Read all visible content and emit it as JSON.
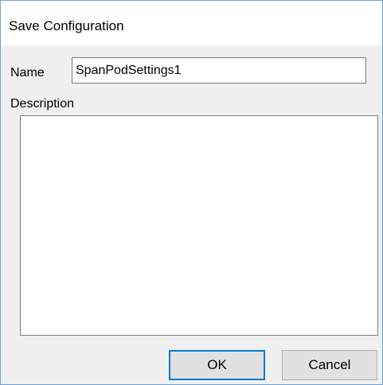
{
  "dialog": {
    "title": "Save Configuration"
  },
  "form": {
    "name_label": "Name",
    "name_value": "SpanPodSettings1",
    "description_label": "Description",
    "description_value": ""
  },
  "buttons": {
    "ok_label": "OK",
    "cancel_label": "Cancel"
  },
  "colors": {
    "window_border": "#6e9fd6",
    "default_button_border": "#0078d7",
    "dialog_background": "#f0f0f0"
  }
}
